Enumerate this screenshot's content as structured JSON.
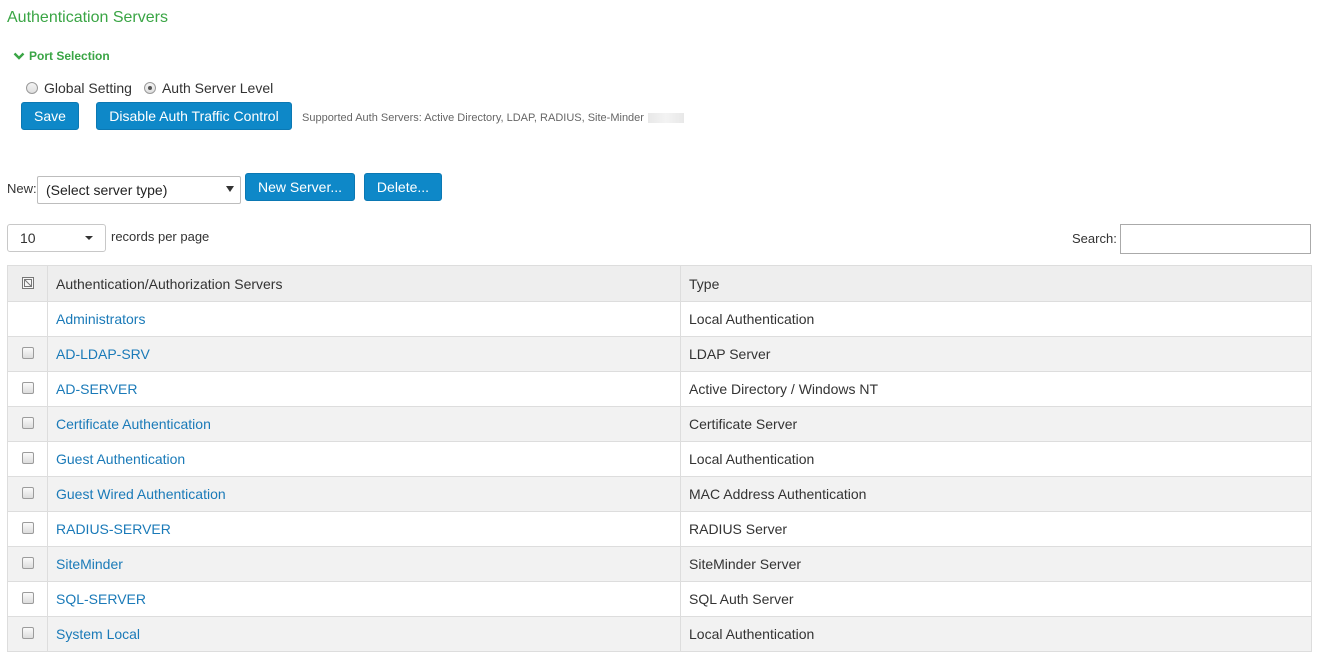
{
  "page": {
    "title": "Authentication Servers"
  },
  "port_selection": {
    "label": "Port Selection",
    "options": [
      {
        "label": "Global Setting",
        "checked": false
      },
      {
        "label": "Auth Server Level",
        "checked": true
      }
    ]
  },
  "actions": {
    "save": "Save",
    "disable_traffic": "Disable Auth Traffic Control",
    "supported_text": "Supported Auth Servers: Active Directory, LDAP, RADIUS, Site-Minder"
  },
  "new_server": {
    "label": "New:",
    "select_value": "(Select server type)",
    "new_button": "New Server...",
    "delete_button": "Delete..."
  },
  "paging": {
    "per_page_value": "10",
    "per_page_label": "records per page",
    "search_label": "Search:",
    "search_value": ""
  },
  "table": {
    "headers": [
      "Authentication/Authorization Servers",
      "Type"
    ],
    "rows": [
      {
        "name": "Administrators",
        "type": "Local Authentication",
        "checkbox": false
      },
      {
        "name": "AD-LDAP-SRV",
        "type": "LDAP Server",
        "checkbox": true
      },
      {
        "name": "AD-SERVER",
        "type": "Active Directory / Windows NT",
        "checkbox": true
      },
      {
        "name": "Certificate Authentication",
        "type": "Certificate Server",
        "checkbox": true
      },
      {
        "name": "Guest Authentication",
        "type": "Local Authentication",
        "checkbox": true
      },
      {
        "name": "Guest Wired Authentication",
        "type": "MAC Address Authentication",
        "checkbox": true
      },
      {
        "name": "RADIUS-SERVER",
        "type": "RADIUS Server",
        "checkbox": true
      },
      {
        "name": "SiteMinder",
        "type": "SiteMinder Server",
        "checkbox": true
      },
      {
        "name": "SQL-SERVER",
        "type": "SQL Auth Server",
        "checkbox": true
      },
      {
        "name": "System Local",
        "type": "Local Authentication",
        "checkbox": true
      }
    ]
  },
  "colors": {
    "title_green": "#3aa545",
    "button_blue": "#0e88c8",
    "link_blue": "#1a7ab8"
  }
}
